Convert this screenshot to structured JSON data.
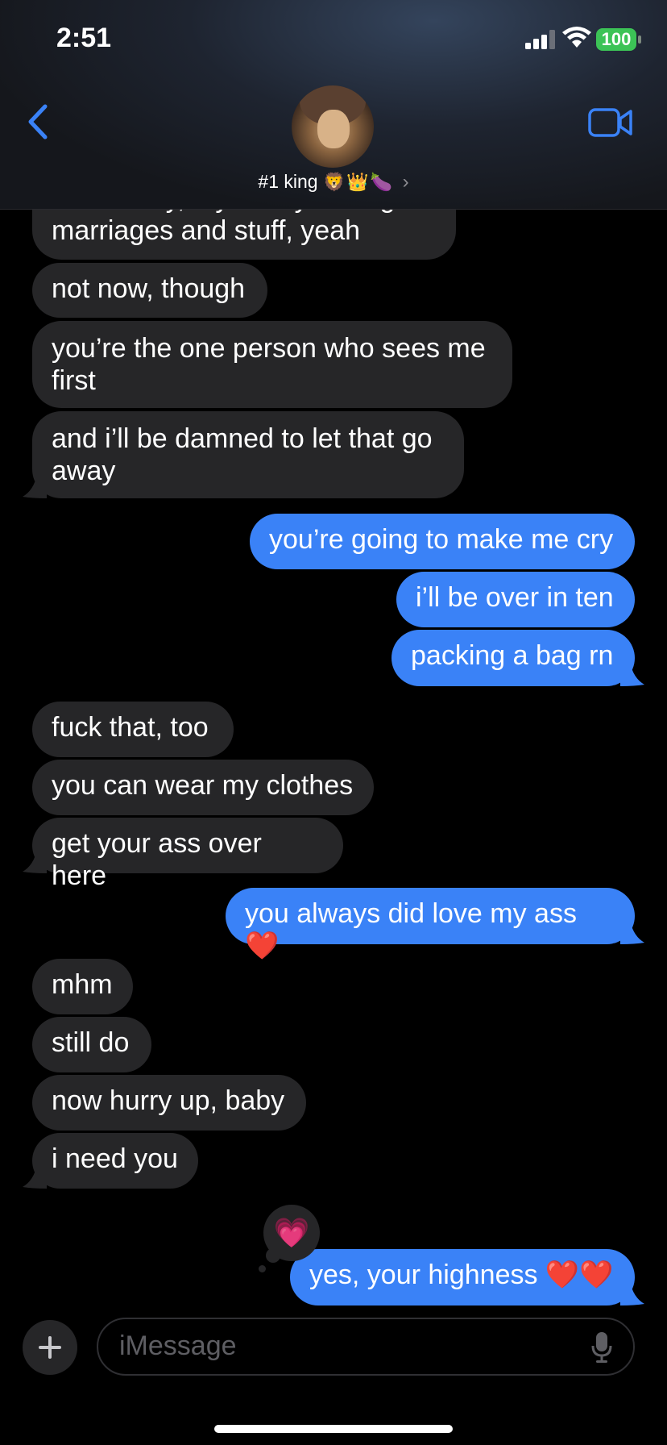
{
  "status_bar": {
    "time": "2:51",
    "battery_level": "100",
    "signal_bars": 3,
    "signal_max": 4
  },
  "header": {
    "contact_name": "#1 king",
    "contact_emojis": "🦁👑🍆",
    "icons": {
      "back": "chevron-left-icon",
      "video": "video-camera-icon",
      "avatar": "contact-avatar"
    },
    "accent_color": "#3a82f7"
  },
  "messages": [
    {
      "from": "them",
      "text": "historically, my family arranged\nmarriages and stuff, yeah"
    },
    {
      "from": "them",
      "text": "not now, though"
    },
    {
      "from": "them",
      "text": "you’re the one person who sees me\nfirst"
    },
    {
      "from": "them",
      "text": "and i’ll be damned to let that go\naway"
    },
    {
      "from": "me",
      "text": "you’re going to make me cry"
    },
    {
      "from": "me",
      "text": "i’ll be over in ten"
    },
    {
      "from": "me",
      "text": "packing a bag rn"
    },
    {
      "from": "them",
      "text": "fuck that, too"
    },
    {
      "from": "them",
      "text": "you can wear my clothes"
    },
    {
      "from": "them",
      "text": "get your ass over here"
    },
    {
      "from": "me",
      "text": "you always did love my ass ❤️"
    },
    {
      "from": "them",
      "text": "mhm"
    },
    {
      "from": "them",
      "text": "still do"
    },
    {
      "from": "them",
      "text": "now hurry up, baby"
    },
    {
      "from": "them",
      "text": "i need you"
    },
    {
      "from": "me",
      "text": "yes, your highness ❤️❤️",
      "tapback": "💗"
    }
  ],
  "composer": {
    "placeholder": "iMessage",
    "icons": {
      "plus": "plus-icon",
      "mic": "microphone-icon"
    }
  },
  "colors": {
    "incoming_bubble": "#262628",
    "outgoing_bubble": "#3a82f7",
    "background": "#000000",
    "battery": "#3cc356"
  }
}
